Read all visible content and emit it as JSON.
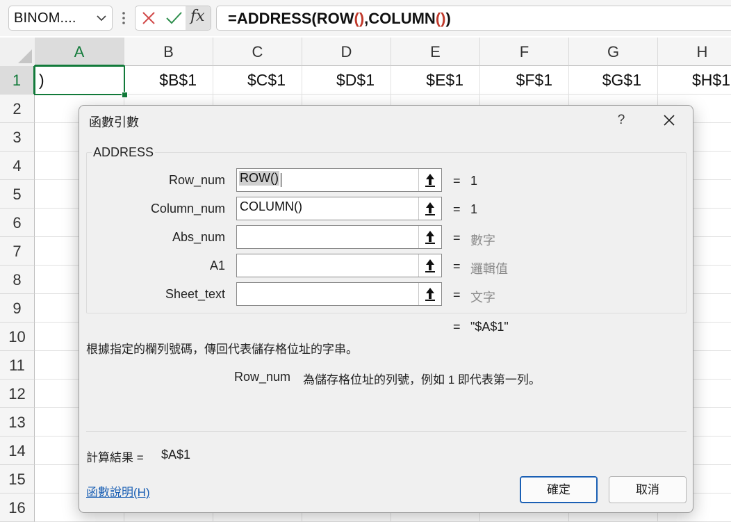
{
  "formula_bar": {
    "name_box": "BINOM....",
    "fx_label": "fx",
    "formula_parts": [
      "=ADDRESS(ROW",
      "()",
      ",COLUMN",
      "()",
      ")"
    ]
  },
  "sheet": {
    "columns": [
      "A",
      "B",
      "C",
      "D",
      "E",
      "F",
      "G",
      "H"
    ],
    "rows": [
      "1",
      "2",
      "3",
      "4",
      "5",
      "6",
      "7",
      "8",
      "9",
      "10",
      "11",
      "12",
      "13",
      "14",
      "15",
      "16"
    ],
    "row1_values": [
      ")",
      "$B$1",
      "$C$1",
      "$D$1",
      "$E$1",
      "$F$1",
      "$G$1",
      "$H$1"
    ]
  },
  "dialog": {
    "title": "函數引數",
    "help_glyph": "?",
    "function_name": "ADDRESS",
    "args": [
      {
        "label": "Row_num",
        "value": "ROW()",
        "result": "1"
      },
      {
        "label": "Column_num",
        "value": "COLUMN()",
        "result": "1"
      },
      {
        "label": "Abs_num",
        "value": "",
        "result": "數字"
      },
      {
        "label": "A1",
        "value": "",
        "result": "邏輯值"
      },
      {
        "label": "Sheet_text",
        "value": "",
        "result": "文字"
      }
    ],
    "equals": "=",
    "formula_result": "\"$A$1\"",
    "description": "根據指定的欄列號碼，傳回代表儲存格位址的字串。",
    "arg_desc_name": "Row_num",
    "arg_desc_text": "為儲存格位址的列號，例如 1 即代表第一列。",
    "calc_label": "計算結果 =",
    "calc_value": "$A$1",
    "help_link": "函數說明(H)",
    "ok_label": "確定",
    "cancel_label": "取消"
  },
  "colors": {
    "accent_green": "#127a3a",
    "paren_red": "#c0392b",
    "link_blue": "#1a5fb4"
  }
}
